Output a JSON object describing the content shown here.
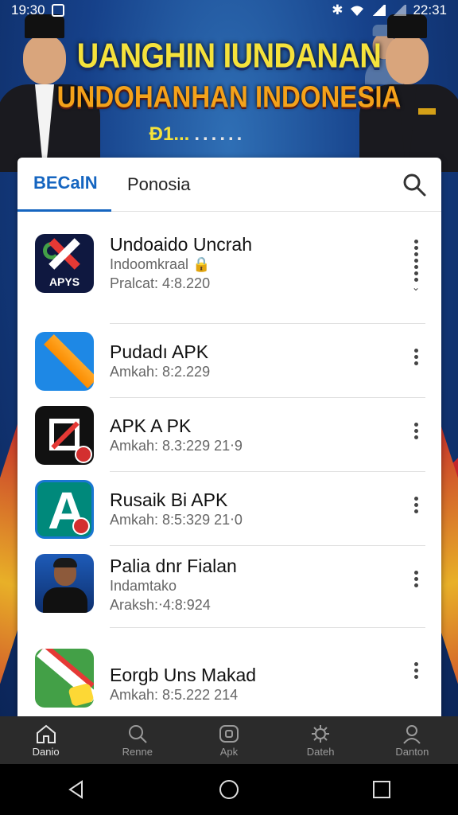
{
  "status_bar": {
    "time": "19:30",
    "clock_right": "22:31"
  },
  "banner": {
    "line1": "UANGHIN IUNDANAN",
    "line2": "UNDOHANHAN INDONESIA",
    "line3_prefix": "Đ1...",
    "line3_dots": "......"
  },
  "tabs": [
    {
      "label": "BECalN"
    },
    {
      "label": "Ponosia"
    }
  ],
  "apps": [
    {
      "name": "Undoaido Uncrah",
      "sub1": "Indoomkraal",
      "sub2": "Pralcat: 4:8.220",
      "icon_label": "APYS"
    },
    {
      "name": "Pudadı APK",
      "sub1": "Amkah: 8:2.229"
    },
    {
      "name": "APK A PK",
      "sub1": "Amkah: 8.3:229 21⋅9"
    },
    {
      "name": "Rusaik Bi APK",
      "sub1": "Amkah: 8:5:329 21⋅0"
    },
    {
      "name": "Palia dnr Fialan",
      "sub1": "Indamtako",
      "sub2": "Araksh:⋅4:8:924"
    },
    {
      "name": "Eorgb Uns Makad",
      "sub1": "Amkah: 8:5.222 214"
    }
  ],
  "bottom_nav": [
    {
      "label": "Danio",
      "icon": "home-icon"
    },
    {
      "label": "Renne",
      "icon": "search-icon"
    },
    {
      "label": "Apk",
      "icon": "apk-icon"
    },
    {
      "label": "Dateh",
      "icon": "gear-icon"
    },
    {
      "label": "Danton",
      "icon": "profile-icon"
    }
  ],
  "colors": {
    "accent": "#1565c0",
    "banner_yellow": "#f5e23b",
    "banner_orange": "#f4a21a",
    "nav_bg": "#2b2b2b"
  }
}
